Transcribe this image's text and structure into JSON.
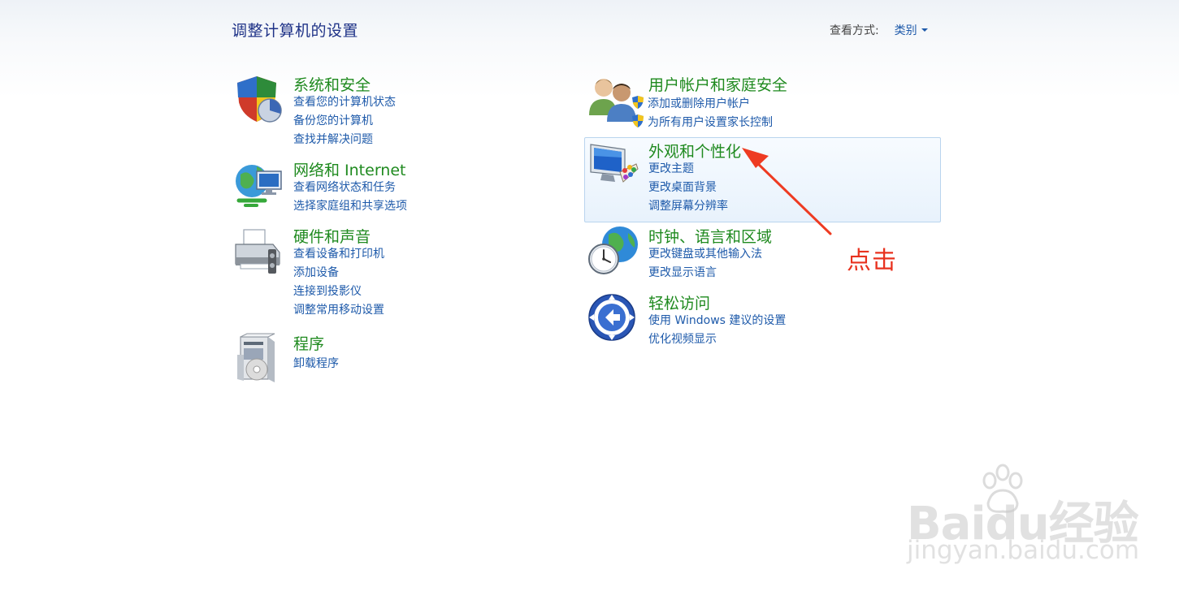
{
  "header": {
    "title": "调整计算机的设置",
    "view_by_label": "查看方式:",
    "view_by_value": "类别"
  },
  "categories": [
    {
      "title": "系统和安全",
      "icon": "shield-pie-icon",
      "links": [
        "查看您的计算机状态",
        "备份您的计算机",
        "查找并解决问题"
      ]
    },
    {
      "title": "网络和 Internet",
      "icon": "network-globe-icon",
      "links": [
        "查看网络状态和任务",
        "选择家庭组和共享选项"
      ]
    },
    {
      "title": "硬件和声音",
      "icon": "printer-icon",
      "links": [
        "查看设备和打印机",
        "添加设备",
        "连接到投影仪",
        "调整常用移动设置"
      ]
    },
    {
      "title": "程序",
      "icon": "programs-box-icon",
      "links": [
        "卸载程序"
      ]
    },
    {
      "title": "用户帐户和家庭安全",
      "icon": "users-icon",
      "links": [
        "添加或删除用户帐户",
        "为所有用户设置家长控制"
      ]
    },
    {
      "title": "外观和个性化",
      "icon": "monitor-palette-icon",
      "links": [
        "更改主题",
        "更改桌面背景",
        "调整屏幕分辨率"
      ]
    },
    {
      "title": "时钟、语言和区域",
      "icon": "clock-globe-icon",
      "links": [
        "更改键盘或其他输入法",
        "更改显示语言"
      ]
    },
    {
      "title": "轻松访问",
      "icon": "ease-of-access-icon",
      "links": [
        "使用 Windows 建议的设置",
        "优化视频显示"
      ]
    }
  ],
  "annotation": {
    "text": "点击",
    "color": "#e8321f"
  },
  "watermark": {
    "logo": "Baidu经验",
    "url": "jingyan.baidu.com"
  },
  "colors": {
    "category_title": "#1f8a1f",
    "link": "#1e5aaa",
    "page_title": "#1e3287"
  }
}
